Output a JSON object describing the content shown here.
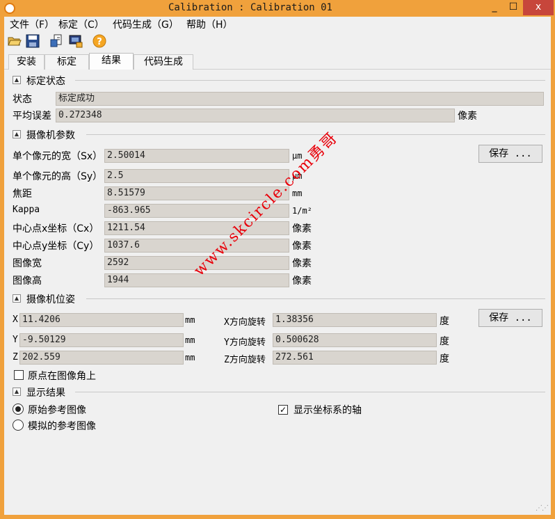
{
  "window": {
    "title": "Calibration : Calibration 01",
    "minimize": "_",
    "maximize": "☐",
    "close": "x"
  },
  "menu": [
    "文件（F）",
    "标定（C）",
    "代码生成（G）",
    "帮助（H）"
  ],
  "toolbar": {
    "icons": [
      "folder-open-icon",
      "save-icon",
      "export-icon",
      "camera-export-icon",
      "help-icon"
    ],
    "help_glyph": "?"
  },
  "tabs": [
    "安装",
    "标定",
    "结果",
    "代码生成"
  ],
  "active_tab": "结果",
  "status_section": {
    "title": "标定状态",
    "status_label": "状态",
    "status_value": "标定成功",
    "error_label": "平均误差",
    "error_value": "0.272348",
    "error_unit": "像素"
  },
  "camera_params": {
    "title": "摄像机参数",
    "save_label": "保存 ...",
    "rows": [
      {
        "label": "单个像元的宽（Sx）",
        "value": "2.50014",
        "unit": "μm"
      },
      {
        "label": "单个像元的高（Sy）",
        "value": "2.5",
        "unit": "μm"
      },
      {
        "label": "焦距",
        "value": "8.51579",
        "unit": "mm"
      },
      {
        "label": "Kappa",
        "value": "-863.965",
        "unit": "1/m²"
      },
      {
        "label": "中心点x坐标（Cx）",
        "value": "1211.54",
        "unit": "像素"
      },
      {
        "label": "中心点y坐标（Cy）",
        "value": "1037.6",
        "unit": "像素"
      },
      {
        "label": "图像宽",
        "value": "2592",
        "unit": "像素"
      },
      {
        "label": "图像高",
        "value": "1944",
        "unit": "像素"
      }
    ]
  },
  "camera_pose": {
    "title": "摄像机位姿",
    "save_label": "保存 ...",
    "rows": [
      {
        "label": "X",
        "value": "11.4206",
        "unit": "mm",
        "rot_label": "X方向旋转",
        "rot_value": "1.38356",
        "rot_unit": "度"
      },
      {
        "label": "Y",
        "value": "-9.50129",
        "unit": "mm",
        "rot_label": "Y方向旋转",
        "rot_value": "0.500628",
        "rot_unit": "度"
      },
      {
        "label": "Z",
        "value": "202.559",
        "unit": "mm",
        "rot_label": "Z方向旋转",
        "rot_value": "272.561",
        "rot_unit": "度"
      }
    ],
    "origin_checkbox": "原点在图像角上"
  },
  "display": {
    "title": "显示结果",
    "radio_original": "原始参考图像",
    "radio_simulated": "模拟的参考图像",
    "axes_checkbox": "显示坐标系的轴",
    "check_mark": "✓"
  },
  "watermark": "www.skcircle.com勇哥",
  "colors": {
    "titlebar": "#f0a13c",
    "close_button": "#c7463b",
    "field_bg": "#d9d5cf",
    "watermark": "#e8000a"
  }
}
